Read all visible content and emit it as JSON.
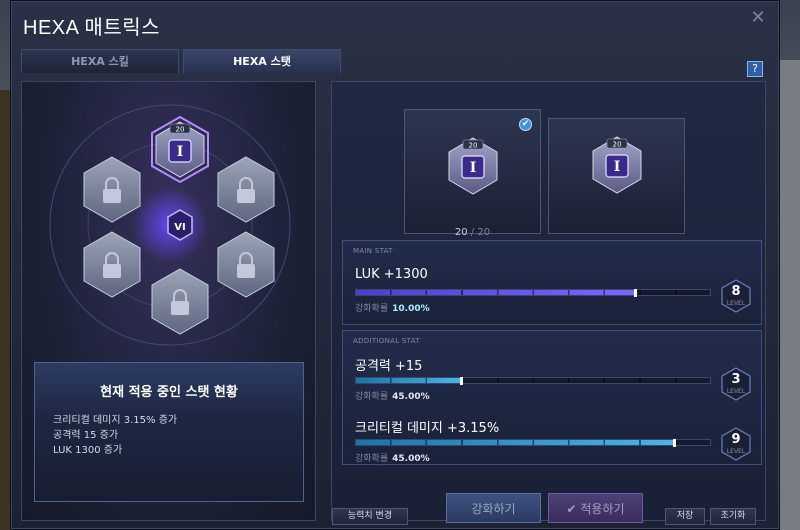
{
  "window": {
    "title": "HEXA 매트릭스",
    "close_label": "✕",
    "help_label": "?"
  },
  "tabs": [
    {
      "label": "HEXA 스킬",
      "active": false
    },
    {
      "label": "HEXA 스탯",
      "active": true
    }
  ],
  "hex_node": {
    "level_badge": "20",
    "glyph": "I",
    "center_glyph": "VI"
  },
  "status": {
    "title": "현재 적용 중인 스탯 현황",
    "lines": [
      "크리티컬 데미지 3.15% 증가",
      "공격력 15 증가",
      "LUK 1300 증가"
    ]
  },
  "slots": {
    "badge": "20",
    "level_current": "20",
    "level_separator": " / ",
    "level_max": "20",
    "check": "✔"
  },
  "main_stat": {
    "section_label": "MAIN STAT",
    "name": "LUK +1300",
    "progress": 0.79,
    "prob_label": "강화확률",
    "prob_value": "10.00%",
    "level": "8",
    "level_label": "LEVEL"
  },
  "additional_stat": {
    "section_label": "ADDITIONAL STAT",
    "stats": [
      {
        "name": "공격력 +15",
        "progress": 0.3,
        "prob_label": "강화확률",
        "prob_value": "45.00%",
        "level": "3",
        "level_label": "LEVEL"
      },
      {
        "name": "크리티컬 데미지 +3.15%",
        "progress": 0.9,
        "prob_label": "강화확률",
        "prob_value": "45.00%",
        "level": "9",
        "level_label": "LEVEL"
      }
    ]
  },
  "buttons": {
    "reset_ability": "능력치 변경",
    "upgrade": "강화하기",
    "apply": "적용하기",
    "save": "저장",
    "initialize": "초기화"
  },
  "colors": {
    "main_bar": "#7c68ff",
    "additional_bar": "#49b7ea",
    "active_node_border": "#b58cff"
  }
}
